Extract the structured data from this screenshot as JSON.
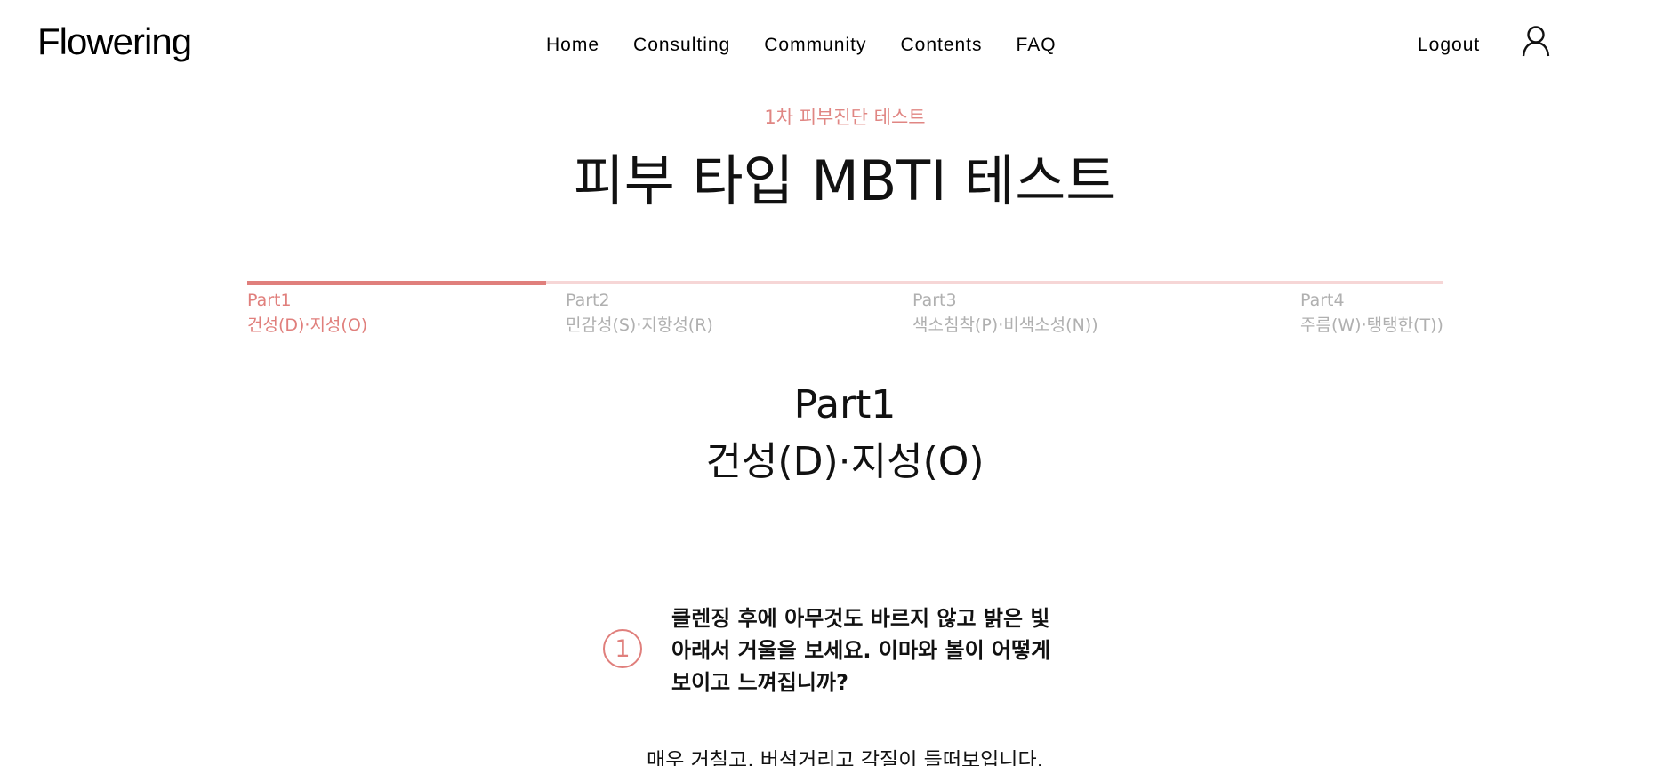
{
  "header": {
    "logo": "Flowering",
    "nav": [
      "Home",
      "Consulting",
      "Community",
      "Contents",
      "FAQ"
    ],
    "logout": "Logout",
    "user_icon": "user-icon"
  },
  "hero": {
    "subtitle": "1차 피부진단 테스트",
    "title": "피부 타입 MBTI 테스트"
  },
  "progress": {
    "fraction": 0.25,
    "steps": [
      {
        "part": "Part1",
        "label": "건성(D)·지성(O)"
      },
      {
        "part": "Part2",
        "label": "민감성(S)·지항성(R)"
      },
      {
        "part": "Part3",
        "label": "색소침착(P)·비색소성(N))"
      },
      {
        "part": "Part4",
        "label": "주름(W)·탱탱한(T))"
      }
    ]
  },
  "section": {
    "part": "Part1",
    "label": "건성(D)·지성(O)"
  },
  "question": {
    "number": "1",
    "lines": [
      "클렌징 후에 아무것도 바르지 않고 밝은 빛",
      "아래서 거울을 보세요. 이마와 볼이 어떻게",
      "보이고 느껴집니까?"
    ],
    "answer": "매우 거칠고, 버석거리고 각질이 들떠보입니다."
  },
  "colors": {
    "accent": "#e07f7c",
    "accent_light": "#f6d6d6",
    "muted": "#b0b0b0"
  }
}
